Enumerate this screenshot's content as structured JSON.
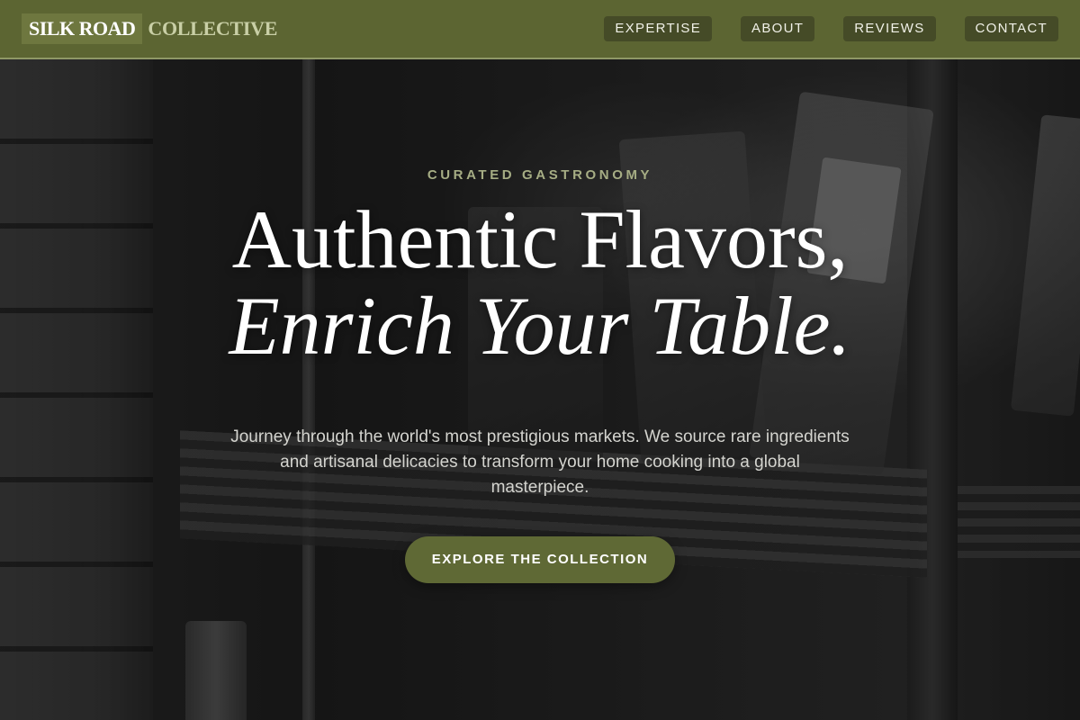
{
  "colors": {
    "nav_bg": "#5c6532",
    "nav_button_bg": "#454b27",
    "accent": "#5f6935",
    "eyebrow": "#a6ad84"
  },
  "nav": {
    "brand_main": "SILK ROAD",
    "brand_sub": "COLLECTIVE",
    "links": [
      {
        "label": "EXPERTISE"
      },
      {
        "label": "ABOUT"
      },
      {
        "label": "REVIEWS"
      },
      {
        "label": "CONTACT"
      }
    ]
  },
  "hero": {
    "eyebrow": "CURATED GASTRONOMY",
    "headline_line1": "Authentic Flavors,",
    "headline_line2": "Enrich Your Table.",
    "subtext": "Journey through the world's most prestigious markets. We source rare ingredients and artisanal delicacies to transform your home cooking into a global masterpiece.",
    "cta_label": "EXPLORE THE COLLECTION"
  }
}
